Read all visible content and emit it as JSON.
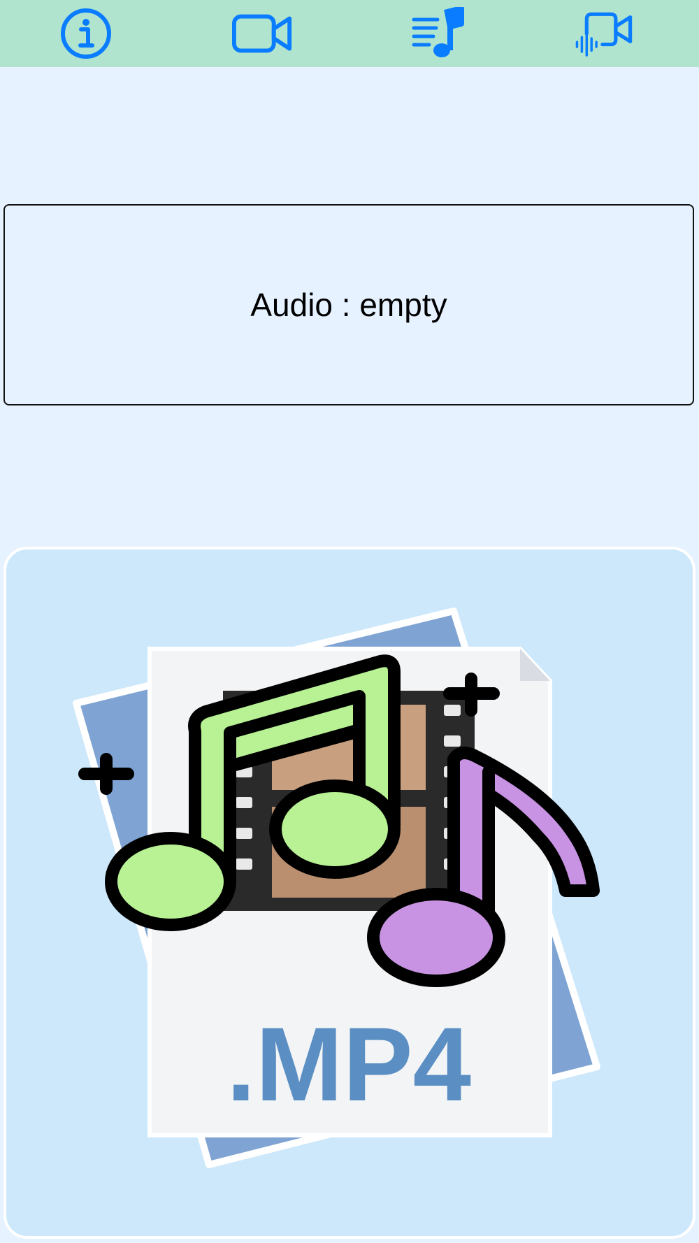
{
  "toolbar": {
    "buttons": [
      {
        "name": "info",
        "icon": "info-icon"
      },
      {
        "name": "video",
        "icon": "video-camera-icon"
      },
      {
        "name": "audio",
        "icon": "music-list-icon"
      },
      {
        "name": "audio-video",
        "icon": "video-with-waveform-icon"
      }
    ],
    "icon_color": "#0a7cff",
    "background": "#b0e4cf"
  },
  "audio_status": {
    "text": "Audio : empty"
  },
  "artwork": {
    "label": ".MP4",
    "icon": "mp4-music-file-icon",
    "note_colors": [
      "#b8f294",
      "#c893e3"
    ]
  }
}
